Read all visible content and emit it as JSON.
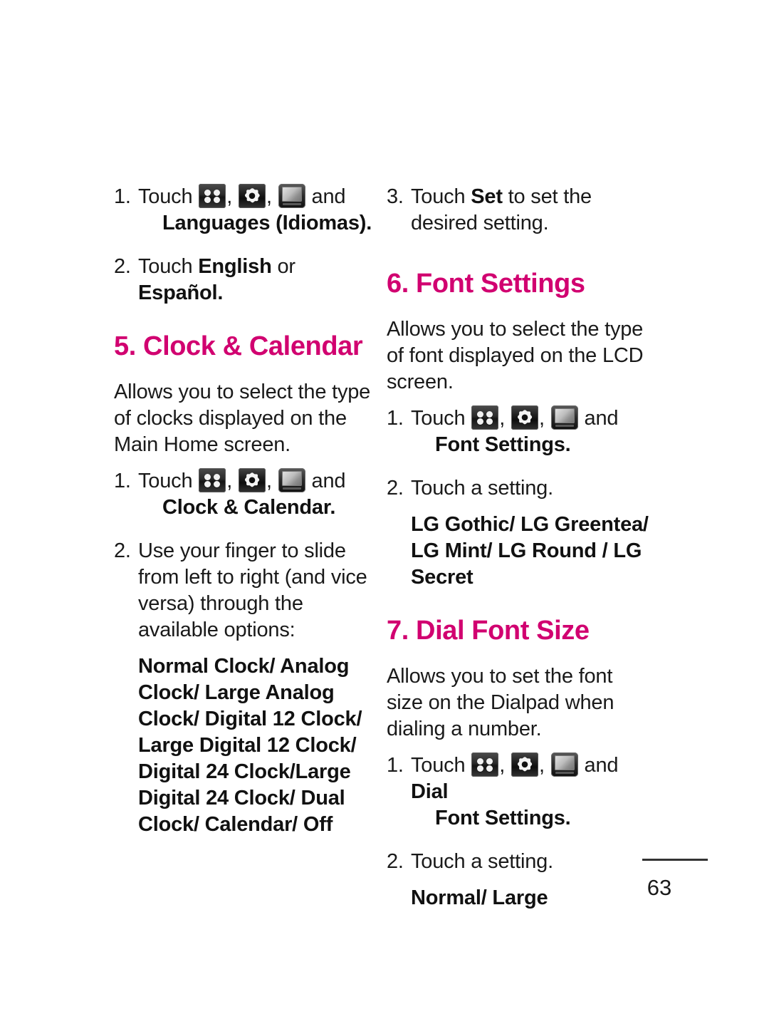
{
  "document": {
    "page_number": "63",
    "accent_color": "#d10070",
    "text_color": "#1a1a1a"
  },
  "icons": {
    "apps_grid": "apps-grid-icon",
    "settings_gear": "settings-gear-icon",
    "display_screen": "display-screen-icon"
  },
  "left_column": {
    "languages_steps": {
      "step1": {
        "number": "1.",
        "text_before_icons": "Touch",
        "separator": ",",
        "text_after_icons": "and",
        "bold_target": "Languages (Idiomas)",
        "period": "."
      },
      "step2": {
        "number": "2.",
        "text_before": "Touch ",
        "bold_1": "English",
        "text_middle": " or ",
        "bold_2": "Español",
        "period": "."
      }
    },
    "clock_calendar": {
      "heading": "5. Clock & Calendar",
      "description": "Allows you to select the type of clocks displayed on the Main Home screen.",
      "step1": {
        "number": "1.",
        "text_before_icons": "Touch",
        "separator": ",",
        "text_after_icons": "and",
        "bold_target": "Clock & Calendar",
        "period": "."
      },
      "step2": {
        "number": "2.",
        "text": "Use your finger to slide from left to right (and vice versa) through the available options:"
      },
      "options": "Normal Clock/ Analog Clock/ Large Analog Clock/ Digital 12 Clock/ Large Digital 12 Clock/ Digital 24 Clock/Large Digital 24 Clock/ Dual Clock/ Calendar/ Off",
      "options_list": [
        "Normal Clock",
        "Analog Clock",
        "Large Analog Clock",
        "Digital 12 Clock",
        "Large Digital 12 Clock",
        "Digital 24 Clock",
        "Large Digital 24 Clock",
        "Dual Clock",
        "Calendar",
        "Off"
      ]
    }
  },
  "right_column": {
    "continued_step": {
      "number": "3.",
      "text_before": "Touch ",
      "bold_1": "Set",
      "text_after": " to set the desired setting."
    },
    "font_settings": {
      "heading": "6. Font Settings",
      "description": "Allows you to select the type of font displayed on the LCD screen.",
      "step1": {
        "number": "1.",
        "text_before_icons": "Touch",
        "separator": ",",
        "text_after_icons": "and",
        "bold_target": "Font Settings",
        "period": "."
      },
      "step2": {
        "number": "2.",
        "text": "Touch a setting."
      },
      "options": "LG Gothic/ LG Greentea/ LG Mint/ LG Round / LG Secret",
      "options_list": [
        "LG Gothic",
        "LG Greentea",
        "LG Mint",
        "LG Round",
        "LG Secret"
      ]
    },
    "dial_font_size": {
      "heading": "7. Dial Font Size",
      "description": "Allows you to set the font size on the Dialpad when dialing a number.",
      "step1": {
        "number": "1.",
        "text_before_icons": "Touch",
        "separator": ",",
        "text_after_icons": "and ",
        "bold_inline": "Dial",
        "bold_target": "Font Settings",
        "period": "."
      },
      "step2": {
        "number": "2.",
        "text": "Touch a setting."
      },
      "options": "Normal/ Large",
      "options_list": [
        "Normal",
        "Large"
      ]
    }
  }
}
